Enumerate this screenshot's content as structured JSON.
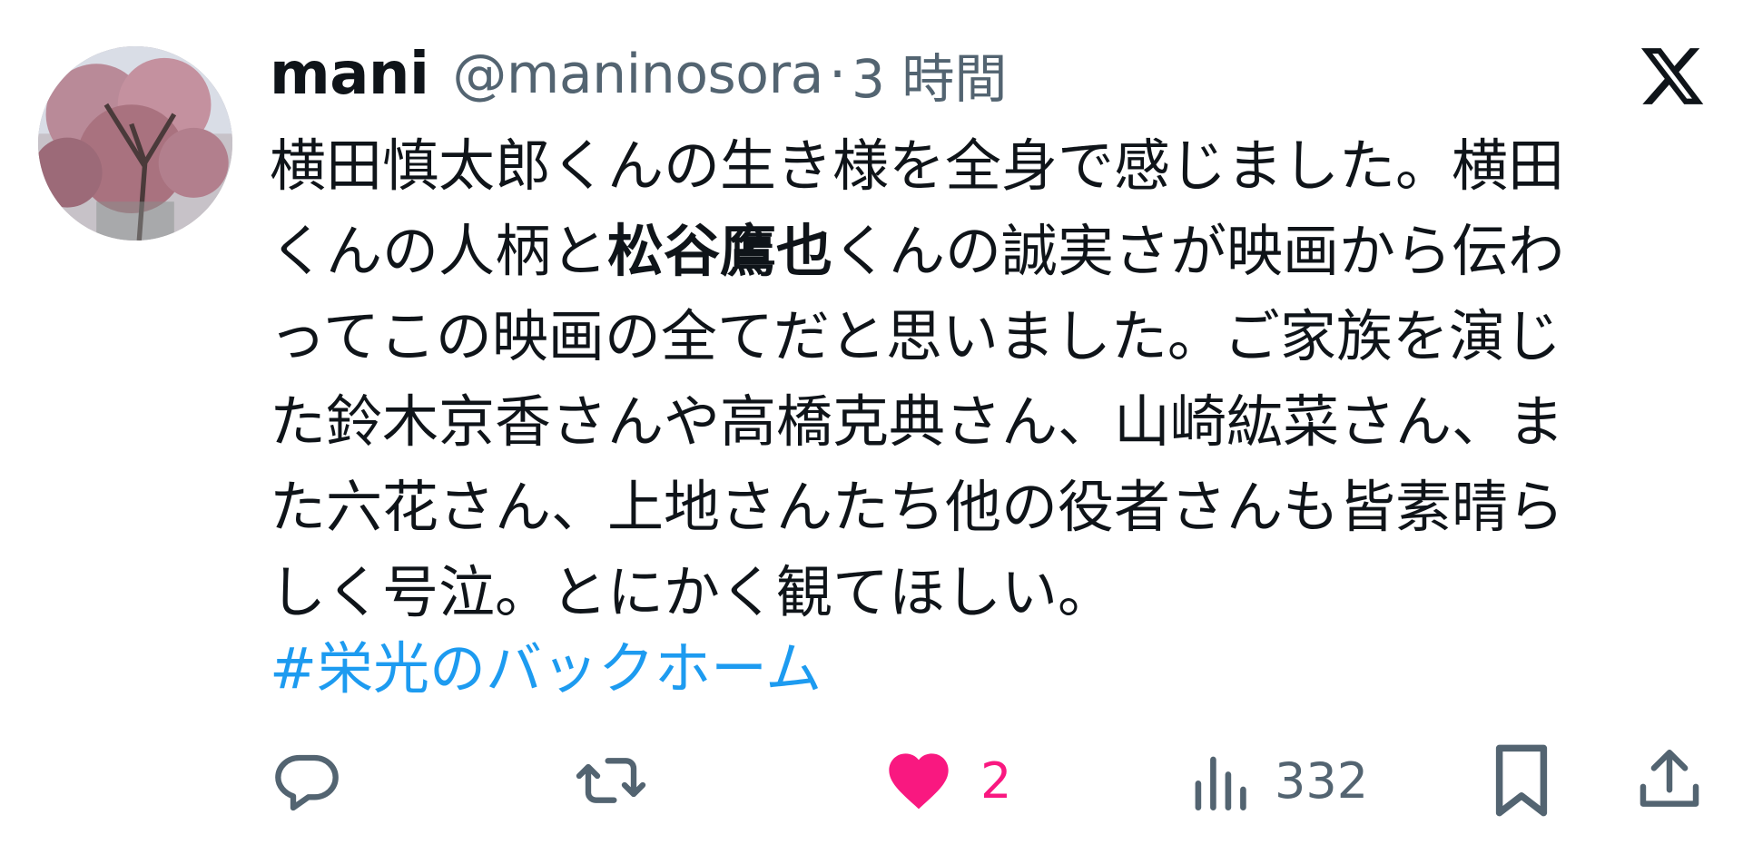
{
  "tweet": {
    "display_name": "mani",
    "handle": "@maninosora",
    "separator": "·",
    "timestamp": "3 時間",
    "body_lines": [
      [
        {
          "text": "横田慎太郎くんの生き様を全身で感じました。横田",
          "bold": false
        }
      ],
      [
        {
          "text": "くんの人柄と",
          "bold": false
        },
        {
          "text": "松谷鷹也",
          "bold": true
        },
        {
          "text": "くんの誠実さが映画から伝わ",
          "bold": false
        }
      ],
      [
        {
          "text": "ってこの映画の全てだと思いました。ご家族を演じ",
          "bold": false
        }
      ],
      [
        {
          "text": "た鈴木京香さんや高橋克典さん、山崎紘菜さん、ま",
          "bold": false
        }
      ],
      [
        {
          "text": "た六花さん、上地さんたち他の役者さんも皆素晴ら",
          "bold": false
        }
      ],
      [
        {
          "text": "しく号泣。とにかく観てほしい。",
          "bold": false
        }
      ]
    ],
    "hashtag": "#栄光のバックホーム"
  },
  "actions": {
    "reply_count": "",
    "retweet_count": "",
    "like_count": "2",
    "views_count": "332"
  },
  "icons": {
    "platform_logo": "x-logo-icon",
    "reply": "reply-icon",
    "retweet": "retweet-icon",
    "like": "heart-icon",
    "views": "views-icon",
    "bookmark": "bookmark-icon",
    "share": "share-icon"
  },
  "colors": {
    "text": "#0f1419",
    "secondary": "#536471",
    "link": "#1d9bf0",
    "like": "#f91880"
  }
}
